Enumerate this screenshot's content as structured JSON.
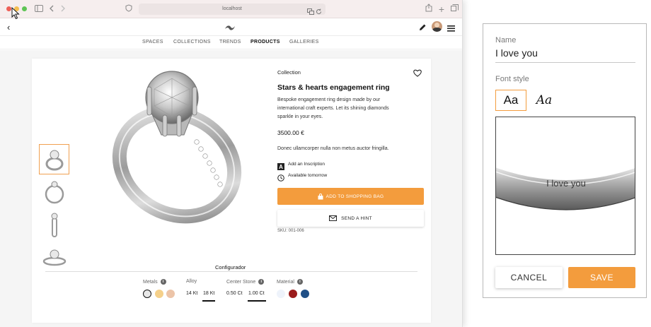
{
  "browser": {
    "url": "localhost"
  },
  "site": {
    "back_label": "‹",
    "nav": [
      "SPACES",
      "COLLECTIONS",
      "TRENDS",
      "PRODUCTS",
      "GALLERIES"
    ],
    "active_nav": "PRODUCTS"
  },
  "product": {
    "collection_label": "Collection",
    "title": "Stars & hearts engagement ring",
    "description_lines": [
      "Bespoke engagement ring design made by our",
      "international craft experts. Let its shining diamonds",
      "sparkle in your eyes."
    ],
    "price": "3500.00 €",
    "note": "Donec ullamcorper nulla non metus auctor fringilla.",
    "features": [
      {
        "icon": "letter-a-icon",
        "label": "Add an Inscription"
      },
      {
        "icon": "clock-icon",
        "label": "Available tomorrow"
      }
    ],
    "add_to_bag_label": "ADD TO SHOPPING BAG",
    "send_hint_label": "SEND A HINT",
    "sku": "SKU: 001-006",
    "thumbnails_count": 4,
    "selected_thumbnail": 0
  },
  "configurator": {
    "title": "Configurador",
    "metals_label": "Metals",
    "metals_swatches": [
      "#e8e8e8",
      "#f5d08a",
      "#ecc4a8"
    ],
    "alloy_label": "Alloy",
    "alloy_options": [
      "14 Kt",
      "18 Kt"
    ],
    "alloy_selected": "18 Kt",
    "stone_label": "Center Stone",
    "stone_options": [
      "0.50 Ct",
      "1.00 Ct"
    ],
    "stone_selected": "1.00 Ct",
    "material_label": "Material",
    "material_swatches": [
      "#eef3fb",
      "#9b1c1c",
      "#1f4f86"
    ]
  },
  "inscription_panel": {
    "name_label": "Name",
    "name_value": "I love you",
    "font_style_label": "Font style",
    "font_options": [
      "Aa",
      "Aa"
    ],
    "selected_font": 0,
    "preview_text": "I love you",
    "cancel_label": "CANCEL",
    "save_label": "SAVE",
    "accent_color": "#f39c3d"
  }
}
